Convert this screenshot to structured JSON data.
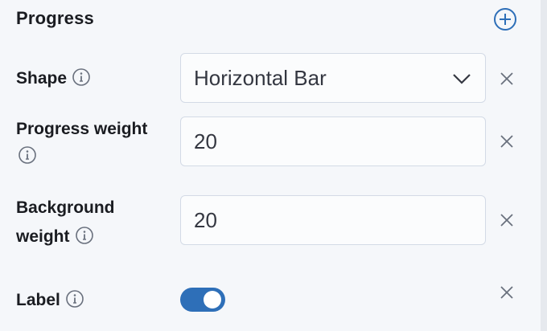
{
  "section": {
    "title": "Progress"
  },
  "fields": {
    "shape": {
      "label": "Shape",
      "value": "Horizontal Bar"
    },
    "progress_weight": {
      "label": "Progress weight",
      "value": "20"
    },
    "background_weight": {
      "label_line1": "Background",
      "label_line2": "weight",
      "value": "20"
    },
    "label_toggle": {
      "label": "Label",
      "checked": true
    }
  },
  "icons": {
    "add": "plus-in-circle-icon",
    "info": "info-icon",
    "chevron": "chevron-down-icon",
    "clear": "close-icon"
  },
  "colors": {
    "accent": "#2e6fb8",
    "text": "#1a1c21",
    "icon_muted": "#69707d",
    "field_border": "#d3dae6",
    "background": "#f5f7fa"
  }
}
